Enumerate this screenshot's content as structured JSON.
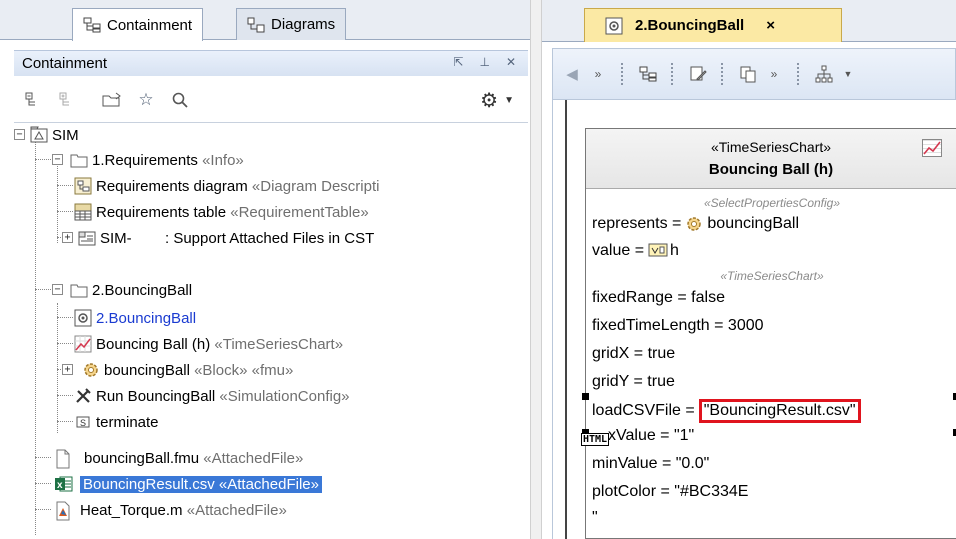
{
  "left_panel": {
    "tabs": [
      {
        "label": "Containment",
        "icon": "containment-tree-icon",
        "active": true
      },
      {
        "label": "Diagrams",
        "icon": "diagrams-tree-icon",
        "active": false
      }
    ],
    "title": "Containment",
    "title_controls": [
      "float-icon",
      "pin-icon",
      "close-icon"
    ],
    "toolbar_icons": [
      "collapse-all-icon",
      "expand-all-icon",
      "open-folder-icon",
      "favorite-star-icon",
      "search-icon",
      "gear-icon"
    ],
    "tree": [
      {
        "label": "SIM",
        "stereo": "",
        "icon": "model-icon"
      },
      {
        "label": "1.Requirements",
        "stereo": "«Info»",
        "icon": "folder-icon"
      },
      {
        "label": "Requirements diagram",
        "stereo": "«Diagram Descripti",
        "icon": "requirements-diagram-icon"
      },
      {
        "label": "Requirements table",
        "stereo": "«RequirementTable»",
        "icon": "requirements-table-icon"
      },
      {
        "label": "SIM-        : Support Attached Files in CST",
        "stereo": "",
        "icon": "requirement-icon"
      },
      {
        "label": "2.BouncingBall",
        "stereo": "",
        "icon": "folder-icon"
      },
      {
        "label": "2.BouncingBall",
        "stereo": "",
        "icon": "diagram-icon"
      },
      {
        "label": "Bouncing Ball (h)",
        "stereo": "«TimeSeriesChart»",
        "icon": "time-series-chart-icon"
      },
      {
        "label": "bouncingBall",
        "stereo": "«Block» «fmu»",
        "icon": "block-icon"
      },
      {
        "label": "Run BouncingBall",
        "stereo": "«SimulationConfig»",
        "icon": "simulation-config-icon"
      },
      {
        "label": "terminate",
        "stereo": "",
        "icon": "signal-icon"
      },
      {
        "label": "bouncingBall.fmu",
        "stereo": "«AttachedFile»",
        "icon": "file-icon"
      },
      {
        "label": "BouncingResult.csv",
        "stereo": "«AttachedFile»",
        "icon": "excel-file-icon"
      },
      {
        "label": "Heat_Torque.m",
        "stereo": "«AttachedFile»",
        "icon": "matlab-file-icon"
      }
    ]
  },
  "right_panel": {
    "tab": {
      "label": "2.BouncingBall",
      "close": "×"
    },
    "toolbar_icons": [
      "back-arrow-icon",
      "overflow-chevron-icon",
      "tree-icon",
      "edit-icon",
      "copy-icon",
      "overflow-chevron-icon",
      "layout-icon",
      "dropdown-arrow-icon"
    ],
    "block": {
      "stereotype": "«TimeSeriesChart»",
      "name": "Bouncing Ball (h)",
      "config_select": "«SelectPropertiesConfig»",
      "represents_label": "represents =",
      "represents_value": "bouncingBall",
      "value_label": "value =",
      "value_value": "h",
      "config_chart": "«TimeSeriesChart»",
      "fixed_range": "fixedRange = false",
      "fixed_time_length": "fixedTimeLength = 3000",
      "grid_x": "gridX = true",
      "grid_y": "gridY = true",
      "load_csv_label": "loadCSVFile =",
      "load_csv_value": "\"BouncingResult.csv\"",
      "html_badge": "HTML",
      "max_value": "xValue = \"1\"",
      "min_value": "minValue = \"0.0\"",
      "plot_color": "plotColor = \"#BC334E",
      "continuation": "\""
    }
  },
  "colors": {
    "selection": "#3a78d7",
    "active_tab": "#fbe9a4",
    "highlight_border": "#e0141e",
    "link_blue": "#1a3bd1"
  }
}
